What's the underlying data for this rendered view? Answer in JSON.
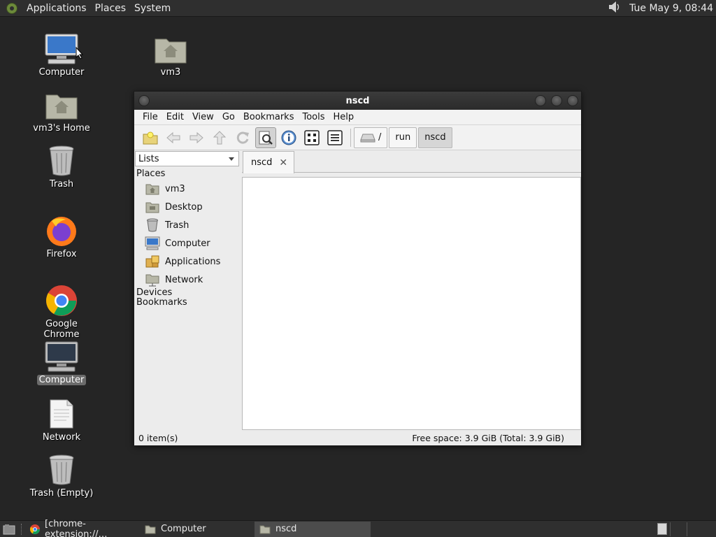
{
  "top_panel": {
    "menus": [
      "Applications",
      "Places",
      "System"
    ],
    "clock": "Tue May  9, 08:44",
    "icons": [
      "gnome-foot-icon",
      "speaker-icon"
    ]
  },
  "desktop": {
    "icons": [
      {
        "label": "Computer",
        "icon": "computer-icon"
      },
      {
        "label": "vm3",
        "icon": "home-folder-icon"
      },
      {
        "label": "vm3's Home",
        "icon": "home-folder-icon"
      },
      {
        "label": "Trash",
        "icon": "trash-icon"
      },
      {
        "label": "Firefox",
        "icon": "firefox-icon"
      },
      {
        "label": "Google Chrome",
        "icon": "chrome-icon"
      },
      {
        "label": "Computer",
        "icon": "computer-icon",
        "selected": true
      },
      {
        "label": "Network",
        "icon": "document-icon"
      },
      {
        "label": "Trash (Empty)",
        "icon": "trash-icon"
      }
    ]
  },
  "window": {
    "title": "nscd",
    "menu": [
      "File",
      "Edit",
      "View",
      "Go",
      "Bookmarks",
      "Tools",
      "Help"
    ],
    "toolbar_icons": [
      "new-folder-icon",
      "back-icon",
      "forward-icon",
      "up-icon",
      "reload-icon",
      "search-icon",
      "info-icon",
      "icon-view-icon",
      "list-view-icon"
    ],
    "path": [
      "/",
      "run",
      "nscd"
    ],
    "side_pane": {
      "combo": "Lists",
      "places_header": "Places",
      "places": [
        {
          "label": "vm3",
          "icon": "home-folder-icon"
        },
        {
          "label": "Desktop",
          "icon": "desktop-folder-icon"
        },
        {
          "label": "Trash",
          "icon": "trash-icon"
        },
        {
          "label": "Computer",
          "icon": "computer-icon"
        },
        {
          "label": "Applications",
          "icon": "applications-icon"
        },
        {
          "label": "Network",
          "icon": "network-folder-icon"
        }
      ],
      "devices_header": "Devices",
      "bookmarks_header": "Bookmarks"
    },
    "tab": {
      "label": "nscd",
      "close": "✕"
    },
    "status": {
      "items": "0 item(s)",
      "free_space": "Free space: 3.9 GiB (Total: 3.9 GiB)"
    }
  },
  "taskbar": {
    "tasks": [
      {
        "label": "[chrome-extension://…",
        "icon": "chrome-icon"
      },
      {
        "label": "Computer",
        "icon": "folder-icon"
      },
      {
        "label": "nscd",
        "icon": "folder-icon",
        "active": true
      }
    ]
  },
  "colors": {
    "panel": "#2f2f2f",
    "desktop": "#252525",
    "window_bg": "#ececec"
  }
}
